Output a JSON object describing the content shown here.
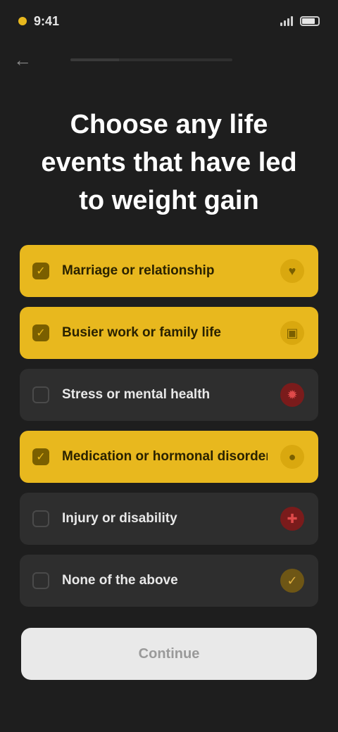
{
  "status_bar": {
    "time": "9:41"
  },
  "nav": {
    "back_icon": "arrow-left-icon",
    "progress_percent": 30
  },
  "title": "Choose any life events that have led to weight gain",
  "options": [
    {
      "label": "Marriage or relationship",
      "selected": true,
      "icon": "heart-icon"
    },
    {
      "label": "Busier work or family life",
      "selected": true,
      "icon": "briefcase-icon"
    },
    {
      "label": "Stress or mental health",
      "selected": false,
      "icon": "brain-icon",
      "icon_color": "red"
    },
    {
      "label": "Medication or hormonal disorder",
      "selected": true,
      "icon": "pill-icon"
    },
    {
      "label": "Injury or disability",
      "selected": false,
      "icon": "bandage-icon",
      "icon_color": "red"
    },
    {
      "label": "None of the above",
      "selected": false,
      "icon": "check-icon",
      "icon_color": "amber"
    }
  ],
  "cta": {
    "label": "Continue"
  },
  "colors": {
    "accent": "#e8b81e",
    "background": "#1e1e1e",
    "card": "#2e2e2e",
    "cta": "#e9e9e9"
  }
}
